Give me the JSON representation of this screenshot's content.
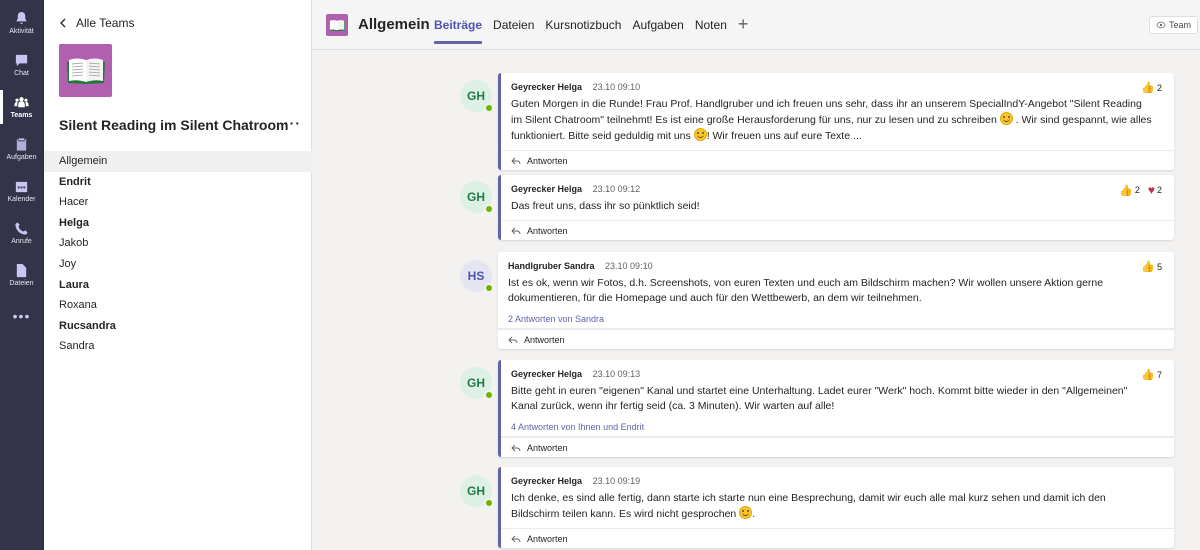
{
  "appbar": {
    "items": [
      {
        "label": "Aktivität",
        "icon": "bell-icon"
      },
      {
        "label": "Chat",
        "icon": "chat-icon"
      },
      {
        "label": "Teams",
        "icon": "teams-icon"
      },
      {
        "label": "Aufgaben",
        "icon": "clipboard-icon"
      },
      {
        "label": "Kalender",
        "icon": "calendar-icon"
      },
      {
        "label": "Anrufe",
        "icon": "phone-icon"
      },
      {
        "label": "Dateien",
        "icon": "file-icon"
      }
    ],
    "more": "•••"
  },
  "teampanel": {
    "back_label": "Alle Teams",
    "team_name": "Silent Reading im Silent Chatroom",
    "more": "···",
    "channels": [
      "Allgemein",
      "Endrit",
      "Hacer",
      "Helga",
      "Jakob",
      "Joy",
      "Laura",
      "Roxana",
      "Rucsandra",
      "Sandra"
    ]
  },
  "header": {
    "channel_title": "Allgemein",
    "tabs": [
      "Beiträge",
      "Dateien",
      "Kursnotizbuch",
      "Aufgaben",
      "Noten"
    ],
    "add": "+",
    "team_button": "Team"
  },
  "posts": [
    {
      "initials": "GH",
      "author": "Geyrecker Helga",
      "time": "23.10 09:10",
      "text_a": "Guten Morgen in die Runde! Frau Prof. Handlgruber und ich freuen uns sehr, dass ihr an unserem SpecialIndY-Angebot \"Silent Reading im Silent Chatroom\" teilnehmt! Es ist eine große Herausforderung für uns, nur zu lesen und zu schreiben ",
      "text_b": " . Wir sind gespannt, wie alles funktioniert. Bitte seid geduldig mit uns ",
      "text_c": "! Wir freuen uns auf eure Texte ...",
      "likes": "2",
      "reply": "Antworten"
    },
    {
      "initials": "GH",
      "author": "Geyrecker Helga",
      "time": "23.10 09:12",
      "text": "Das freut uns, dass ihr so pünktlich seid!",
      "likes": "2",
      "hearts": "2",
      "reply": "Antworten"
    },
    {
      "initials": "HS",
      "author": "Handlgruber Sandra",
      "time": "23.10 09:10",
      "text": "Ist es ok, wenn wir Fotos, d.h. Screenshots, von euren Texten und euch am Bildschirm machen? Wir wollen unsere Aktion gerne dokumentieren, für die Homepage und auch für den Wettbewerb, an dem wir teilnehmen.",
      "likes": "5",
      "replies_link": "2 Antworten von Sandra",
      "reply": "Antworten"
    },
    {
      "initials": "GH",
      "author": "Geyrecker Helga",
      "time": "23.10 09:13",
      "text": "Bitte geht in euren \"eigenen\" Kanal und startet eine Unterhaltung. Ladet eurer \"Werk\" hoch. Kommt bitte wieder in den \"Allgemeinen\" Kanal zurück, wenn ihr fertig seid (ca. 3 Minuten). Wir warten auf alle!",
      "likes": "7",
      "replies_link": "4 Antworten von Ihnen und Endrit",
      "reply": "Antworten"
    },
    {
      "initials": "GH",
      "author": "Geyrecker Helga",
      "time": "23.10 09:19",
      "text_a": "Ich denke, es sind alle fertig, dann starte ich starte nun eine Besprechung, damit wir euch alle mal kurz sehen und damit ich den Bildschirm teilen kann. Es wird nicht gesprochen ",
      "text_b": ".",
      "reply": "Antworten"
    }
  ],
  "colors": {
    "appbar": "#33344a",
    "accent": "#6264a7",
    "team_avatar": "#b15fb0",
    "presence": "#6bb700"
  }
}
